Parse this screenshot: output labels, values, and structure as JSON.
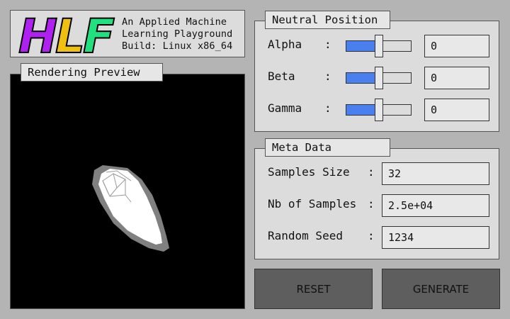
{
  "header": {
    "logo_text": "HLF",
    "logo_colors": [
      "#b020f0",
      "#f0c010",
      "#20e080"
    ],
    "line1": "An Applied Machine",
    "line2": "Learning Playground",
    "line3": "Build: Linux x86_64"
  },
  "preview": {
    "title": "Rendering Preview"
  },
  "neutral_position": {
    "title": "Neutral Position",
    "sliders": [
      {
        "label": "Alpha",
        "colon": ":",
        "value": "0",
        "fill_fraction": 0.5
      },
      {
        "label": "Beta",
        "colon": ":",
        "value": "0",
        "fill_fraction": 0.5
      },
      {
        "label": "Gamma",
        "colon": ":",
        "value": "0",
        "fill_fraction": 0.5
      }
    ]
  },
  "meta_data": {
    "title": "Meta Data",
    "fields": [
      {
        "label": "Samples Size",
        "colon": ":",
        "value": "32"
      },
      {
        "label": "Nb of Samples",
        "colon": ":",
        "value": "2.5e+04"
      },
      {
        "label": "Random Seed",
        "colon": ":",
        "value": "1234"
      }
    ]
  },
  "buttons": {
    "reset": "RESET",
    "generate": "GENERATE"
  },
  "colors": {
    "background": "#b4b4b4",
    "panel": "#dcdcdc",
    "slider_fill": "#4a7ff0",
    "button": "#5e5e5e"
  }
}
